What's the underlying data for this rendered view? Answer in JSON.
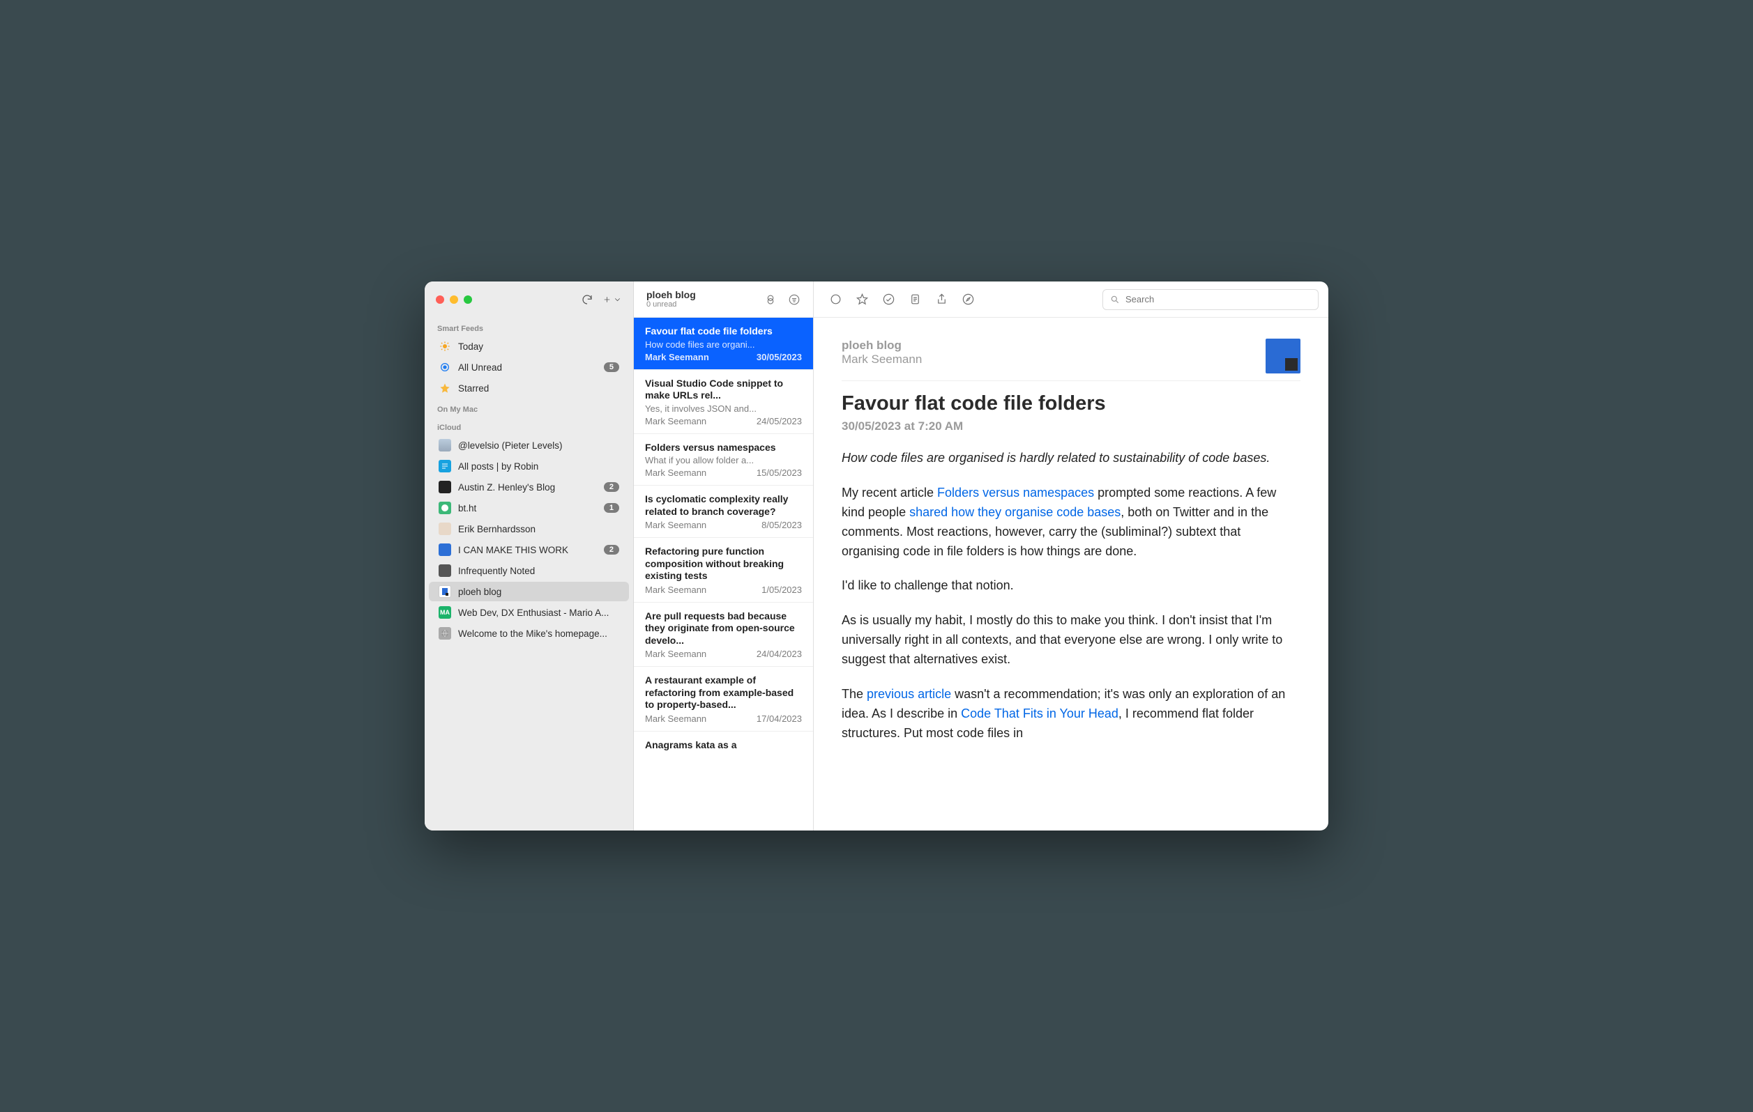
{
  "sidebar": {
    "sections": {
      "smart_label": "Smart Feeds",
      "onmymac_label": "On My Mac",
      "icloud_label": "iCloud"
    },
    "smart": [
      {
        "name": "today",
        "label": "Today"
      },
      {
        "name": "unread",
        "label": "All Unread",
        "badge": "5"
      },
      {
        "name": "starred",
        "label": "Starred"
      }
    ],
    "feeds": [
      {
        "label": "@levelsio (Pieter Levels)"
      },
      {
        "label": "All posts | by Robin"
      },
      {
        "label": "Austin Z. Henley's Blog",
        "badge": "2"
      },
      {
        "label": "bt.ht",
        "badge": "1"
      },
      {
        "label": "Erik Bernhardsson"
      },
      {
        "label": "I CAN MAKE THIS WORK",
        "badge": "2"
      },
      {
        "label": "Infrequently Noted"
      },
      {
        "label": "ploeh blog",
        "selected": true
      },
      {
        "label": "Web Dev, DX Enthusiast - Mario A..."
      },
      {
        "label": "Welcome to the Mike's homepage..."
      }
    ]
  },
  "list": {
    "header": {
      "title": "ploeh blog",
      "subtitle": "0 unread"
    },
    "articles": [
      {
        "title": "Favour flat code file folders",
        "summary": "How code files are organi...",
        "author": "Mark Seemann",
        "date": "30/05/2023",
        "selected": true
      },
      {
        "title": "Visual Studio Code snippet to make URLs rel...",
        "summary": "Yes, it involves JSON and...",
        "author": "Mark Seemann",
        "date": "24/05/2023"
      },
      {
        "title": "Folders versus namespaces",
        "summary": "What if you allow folder a...",
        "author": "Mark Seemann",
        "date": "15/05/2023"
      },
      {
        "title": "Is cyclomatic complexity really related to branch coverage?",
        "summary": "",
        "author": "Mark Seemann",
        "date": "8/05/2023"
      },
      {
        "title": "Refactoring pure function composition without breaking existing tests",
        "summary": "",
        "author": "Mark Seemann",
        "date": "1/05/2023"
      },
      {
        "title": "Are pull requests bad because they originate from open-source develo...",
        "summary": "",
        "author": "Mark Seemann",
        "date": "24/04/2023"
      },
      {
        "title": "A restaurant example of refactoring from example-based to property-based...",
        "summary": "",
        "author": "Mark Seemann",
        "date": "17/04/2023"
      },
      {
        "title": "Anagrams kata as a",
        "summary": "",
        "author": "",
        "date": ""
      }
    ]
  },
  "content": {
    "search_placeholder": "Search",
    "source": "ploeh blog",
    "author": "Mark Seemann",
    "title": "Favour flat code file folders",
    "date": "30/05/2023 at 7:20 AM",
    "intro": "How code files are organised is hardly related to sustainability of code bases.",
    "p2_a": "My recent article ",
    "p2_link1": "Folders versus namespaces",
    "p2_b": " prompted some reactions. A few kind people ",
    "p2_link2": "shared how they organise code bases",
    "p2_c": ", both on Twitter and in the comments. Most reactions, however, carry the (subliminal?) subtext that organising code in file folders is how things are done.",
    "p3": "I'd like to challenge that notion.",
    "p4": "As is usually my habit, I mostly do this to make you think. I don't insist that I'm universally right in all contexts, and that everyone else are wrong. I only write to suggest that alternatives exist.",
    "p5_a": "The ",
    "p5_link1": "previous article",
    "p5_b": " wasn't a recommendation; it's was only an exploration of an idea. As I describe in ",
    "p5_link2": "Code That Fits in Your Head",
    "p5_c": ", I recommend flat folder structures. Put most code files in"
  }
}
